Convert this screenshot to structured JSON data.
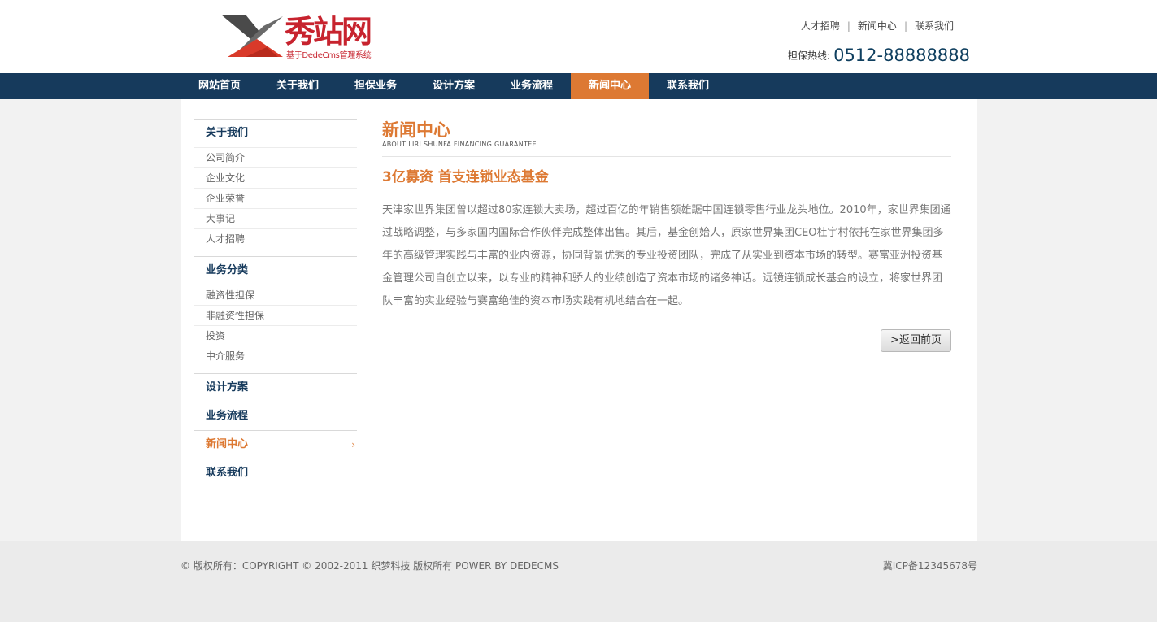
{
  "brand": {
    "logo_text": "秀站网",
    "logo_sub": "基于DedeCms管理系统",
    "logo_red": "#d93a2a",
    "logo_grey": "#4a4a4a"
  },
  "top_links": [
    "人才招聘",
    "新闻中心",
    "联系我们"
  ],
  "hotline": {
    "label": "担保热线:",
    "number": "0512-88888888"
  },
  "nav": {
    "items": [
      "网站首页",
      "关于我们",
      "担保业务",
      "设计方案",
      "业务流程",
      "新闻中心",
      "联系我们"
    ],
    "active_index": 5
  },
  "sidebar": {
    "groups": [
      {
        "title": "关于我们",
        "items": [
          "公司简介",
          "企业文化",
          "企业荣誉",
          "大事记",
          "人才招聘"
        ]
      },
      {
        "title": "业务分类",
        "items": [
          "融资性担保",
          "非融资性担保",
          "投资",
          "中介服务"
        ]
      },
      {
        "title": "设计方案",
        "items": []
      },
      {
        "title": "业务流程",
        "items": []
      },
      {
        "title": "新闻中心",
        "items": [],
        "active": true,
        "chevron": "›"
      },
      {
        "title": "联系我们",
        "items": []
      }
    ]
  },
  "content": {
    "section_title": "新闻中心",
    "section_en": "ABOUT LIRI SHUNFA FINANCING GUARANTEE",
    "article_title": "3亿募资 首支连锁业态基金",
    "article_body": "天津家世界集团曾以超过80家连锁大卖场，超过百亿的年销售额雄踞中国连锁零售行业龙头地位。2010年，家世界集团通过战略调整，与多家国内国际合作伙伴完成整体出售。其后，基金创始人，原家世界集团CEO杜宇村依托在家世界集团多年的高级管理实践与丰富的业内资源，协同背景优秀的专业投资团队，完成了从实业到资本市场的转型。赛富亚洲投资基金管理公司自创立以来，以专业的精神和骄人的业绩创造了资本市场的诸多神话。远镜连锁成长基金的设立，将家世界团队丰富的实业经验与赛富绝佳的资本市场实践有机地结合在一起。",
    "back_label": "返回前页"
  },
  "footer": {
    "copyright": "© 版权所有：COPYRIGHT © 2002-2011 织梦科技 版权所有 POWER BY DEDECMS",
    "icp": "冀ICP备12345678号"
  },
  "colors": {
    "nav_bg": "#163a5c",
    "accent": "#dd7933",
    "footer_bg": "#ebebeb"
  }
}
